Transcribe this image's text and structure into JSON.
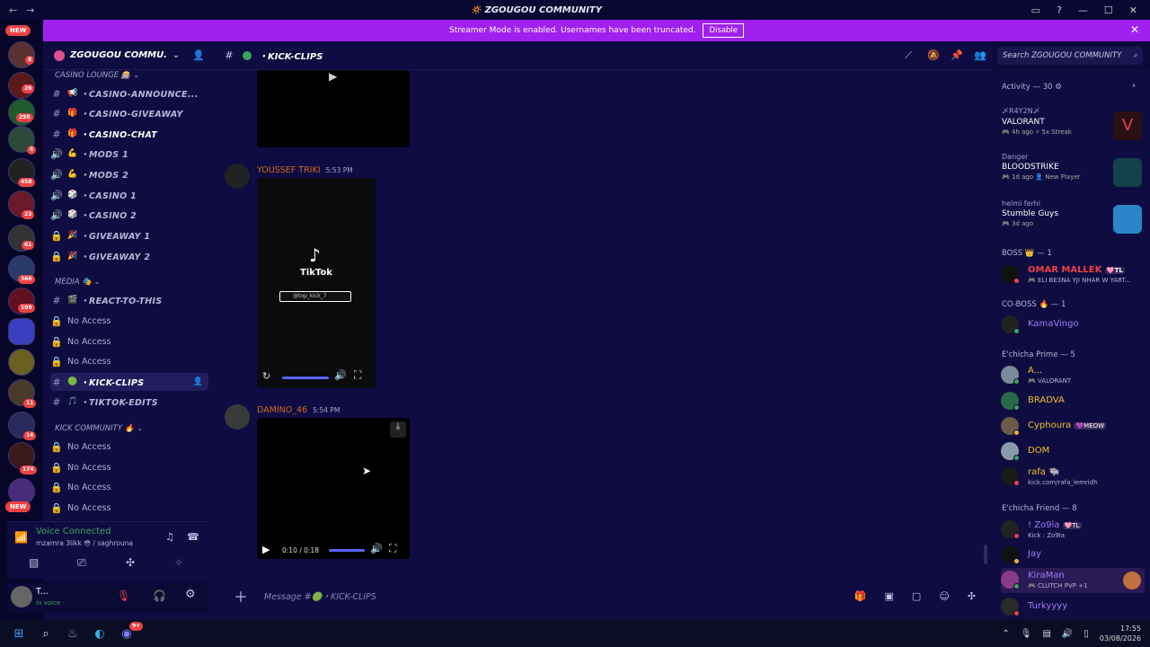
{
  "window": {
    "title": "ZGOUGOU COMMUNITY",
    "title_emoji": "🔅"
  },
  "servers": {
    "new_top": "NEW",
    "new_bottom": "NEW",
    "badges": [
      "8",
      "26",
      "298",
      "6",
      "458",
      "23",
      "61",
      "366",
      "109",
      "11",
      "14",
      "174"
    ]
  },
  "banner": {
    "text": "Streamer Mode is enabled. Usernames have been truncated.",
    "button": "Disable"
  },
  "server": {
    "name": "ZGOUGOU COMMU..."
  },
  "categories": [
    {
      "label": "CASINO LOUNGE 🎰"
    },
    {
      "label": "MEDIA 🎭"
    },
    {
      "label": "KICK COMMUNITY 🔥"
    }
  ],
  "channels": [
    {
      "icon": "#",
      "emoji": "📢",
      "name": "・CASINO-ANNOUNCE..."
    },
    {
      "icon": "#",
      "emoji": "🎁",
      "name": "・CASINO-GIVEAWAY"
    },
    {
      "icon": "#",
      "emoji": "🎁",
      "name": "・CASINO-CHAT"
    },
    {
      "icon": "🔊",
      "emoji": "💪",
      "name": "・MODS 1"
    },
    {
      "icon": "🔊",
      "emoji": "💪",
      "name": "・MODS 2"
    },
    {
      "icon": "🔊",
      "emoji": "🎲",
      "name": "・CASINO 1"
    },
    {
      "icon": "🔊",
      "emoji": "🎲",
      "name": "・CASINO 2"
    },
    {
      "icon": "🔒",
      "emoji": "🎉",
      "name": "・GIVEAWAY 1"
    },
    {
      "icon": "🔒",
      "emoji": "🎉",
      "name": "・GIVEAWAY 2"
    },
    {
      "icon": "#",
      "emoji": "🎬",
      "name": "・REACT-TO-THIS"
    },
    {
      "icon": "🔒",
      "emoji": "",
      "name": "No Access"
    },
    {
      "icon": "🔒",
      "emoji": "",
      "name": "No Access"
    },
    {
      "icon": "🔒",
      "emoji": "",
      "name": "No Access"
    },
    {
      "icon": "#",
      "emoji": "🟢",
      "name": "・KICK-CLIPS"
    },
    {
      "icon": "#",
      "emoji": "🎵",
      "name": "・TIKTOK-EDITS"
    },
    {
      "icon": "🔒",
      "emoji": "",
      "name": "No Access"
    },
    {
      "icon": "🔒",
      "emoji": "",
      "name": "No Access"
    },
    {
      "icon": "🔒",
      "emoji": "",
      "name": "No Access"
    },
    {
      "icon": "🔒",
      "emoji": "",
      "name": "No Access"
    }
  ],
  "voice": {
    "status": "Voice Connected",
    "channel": "mzamra 3likk 😳 / saghrouna"
  },
  "user": {
    "name": "T...",
    "status": "In voice ·"
  },
  "channel_header": {
    "name": "・KICK-CLIPS",
    "search_placeholder": "Search ZGOUGOU COMMUNITY"
  },
  "messages": [
    {
      "author": "YOUSSEF TRIKI",
      "time": "5:53 PM",
      "video_brand": "TikTok",
      "video_handle": "@top_kick_7"
    },
    {
      "author": "DAMINO_46",
      "time": "5:54 PM",
      "video_time": "0:10 / 0:18"
    }
  ],
  "composer": {
    "placeholder": "Message #🟢・KICK-CLIPS"
  },
  "activity": {
    "header": "Activity — 30",
    "items": [
      {
        "user": "〆R4Y2N〆",
        "game": "VALORANT",
        "meta": "4h ago",
        "extra": "5x Streak",
        "color": "#e9415a"
      },
      {
        "user": "Danger",
        "game": "BLOODSTRIKE",
        "meta": "1d ago",
        "extra": "New Player",
        "color": "#3fb8c0"
      },
      {
        "user": "helmi ferhi",
        "game": "Stumble Guys",
        "meta": "3d ago",
        "extra": "",
        "color": "#3ab0e8"
      }
    ]
  },
  "member_sections": [
    {
      "label": "BOSS 👑 — 1"
    },
    {
      "label": "CO-BOSS 🔥 — 1"
    },
    {
      "label": "E'chicha Prime — 5"
    },
    {
      "label": "E'chicha Friend — 8"
    }
  ],
  "members": [
    {
      "name": "OMAR MALLEK",
      "tag": "🩷TL",
      "status": "🎮 ELI BE3NA YJI NHAR W YART...",
      "color": "#ed4245",
      "dot": "#ed4245"
    },
    {
      "name": "KamaVingo",
      "tag": "",
      "status": "",
      "color": "#a27bf5",
      "dot": "#3ba55d"
    },
    {
      "name": "A...",
      "tag": "",
      "status": "🎮 VALORANT",
      "color": "#f0c030",
      "dot": "#3ba55d"
    },
    {
      "name": "BRADVA",
      "tag": "",
      "status": "",
      "color": "#f0c030",
      "dot": "#3ba55d"
    },
    {
      "name": "Cyphoura",
      "tag": "💜MEOW",
      "status": "",
      "color": "#f0c030",
      "dot": "#f0b232"
    },
    {
      "name": "DOM",
      "tag": "",
      "status": "",
      "color": "#f0c030",
      "dot": "#3ba55d"
    },
    {
      "name": "rafa 🐃",
      "tag": "",
      "status": "kick.com/rafa_lemridh",
      "color": "#f0c030",
      "dot": "#ed4245"
    },
    {
      "name": "! Zo9la",
      "tag": "🩷TL",
      "status": "Kick : Zo9la",
      "color": "#a27bf5",
      "dot": "#ed4245"
    },
    {
      "name": "Jay",
      "tag": "",
      "status": "",
      "color": "#a27bf5",
      "dot": "#f0b232"
    },
    {
      "name": "KiraMan",
      "tag": "",
      "status": "🎮 CLUTCH PVP +1",
      "color": "#a27bf5",
      "dot": "#3ba55d"
    },
    {
      "name": "Turkyyyy",
      "tag": "",
      "status": "",
      "color": "#a27bf5",
      "dot": "#ed4245"
    }
  ],
  "taskbar": {
    "time": "17:55",
    "date": "03/08/2026",
    "discord_badge": "9+"
  }
}
